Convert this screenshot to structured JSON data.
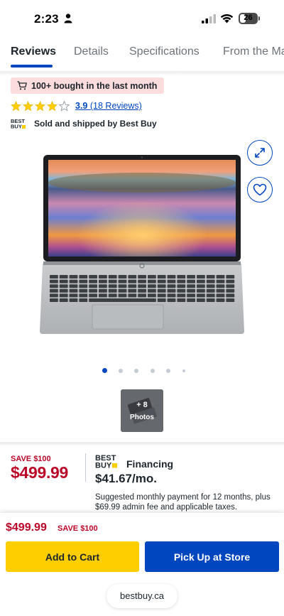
{
  "status_bar": {
    "time": "2:23",
    "battery": "26"
  },
  "tabs": [
    {
      "label": "Reviews",
      "active": true
    },
    {
      "label": "Details",
      "active": false
    },
    {
      "label": "Specifications",
      "active": false
    },
    {
      "label": "From the Ma",
      "active": false
    }
  ],
  "product": {
    "bought_badge": "100+ bought in the last month",
    "rating_value": "3.9",
    "rating_count": "(18 Reviews)",
    "stars_filled": 4,
    "stars_total": 5,
    "seller_text": "Sold and shipped by Best Buy",
    "logo_text_line1": "BEST",
    "logo_text_line2": "BUY",
    "image_dots": 6,
    "active_dot": 0,
    "photos_count": "+ 8",
    "photos_label": "Photos"
  },
  "pricing": {
    "save_tag": "SAVE $100",
    "price": "$499.99",
    "financing_title": "Financing",
    "financing_amount": "$41.67/mo.",
    "financing_desc": "Suggested monthly payment for 12 months, plus $69.99 admin fee and applicable taxes."
  },
  "sticky": {
    "price": "$499.99",
    "save": "SAVE $100",
    "add_to_cart": "Add to Cart",
    "pick_up": "Pick Up at Store",
    "url": "bestbuy.ca"
  },
  "colors": {
    "brand_blue": "#0046be",
    "brand_yellow": "#ffce00",
    "sale_red": "#bb0628",
    "badge_pink": "#fcdcdc"
  },
  "icons": [
    "person-icon",
    "signal-icon",
    "wifi-icon",
    "battery-icon",
    "cart-icon",
    "star-icon",
    "expand-icon",
    "heart-icon"
  ]
}
